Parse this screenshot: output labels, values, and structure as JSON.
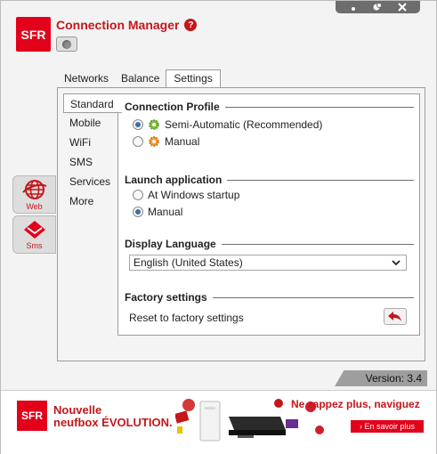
{
  "app": {
    "title": "Connection Manager",
    "logo": "SFR",
    "help": "?"
  },
  "window_controls": [
    "minimize-icon",
    "restore-icon",
    "close-icon"
  ],
  "tabs": [
    {
      "label": "Networks",
      "active": false
    },
    {
      "label": "Balance",
      "active": false
    },
    {
      "label": "Settings",
      "active": true
    }
  ],
  "side_nav": [
    {
      "label": "Standard",
      "active": true
    },
    {
      "label": "Mobile",
      "active": false
    },
    {
      "label": "WiFi",
      "active": false
    },
    {
      "label": "SMS",
      "active": false
    },
    {
      "label": "Services",
      "active": false
    },
    {
      "label": "More",
      "active": false
    }
  ],
  "connection_profile": {
    "title": "Connection Profile",
    "options": [
      {
        "label": "Semi-Automatic (Recommended)",
        "checked": true,
        "icon": "green-gear-icon"
      },
      {
        "label": "Manual",
        "checked": false,
        "icon": "orange-gear-icon"
      }
    ]
  },
  "launch_application": {
    "title": "Launch application",
    "options": [
      {
        "label": "At Windows startup",
        "checked": false
      },
      {
        "label": "Manual",
        "checked": true
      }
    ]
  },
  "display_language": {
    "title": "Display Language",
    "selected": "English (United States)"
  },
  "factory_settings": {
    "title": "Factory settings",
    "reset_label": "Reset to factory settings"
  },
  "left_buttons": [
    {
      "label": "Web",
      "icon": "globe-icon"
    },
    {
      "label": "Sms",
      "icon": "envelope-icon"
    }
  ],
  "version": "Version: 3.4",
  "ad": {
    "logo": "SFR",
    "line1": "Nouvelle",
    "line2": "neufbox ÉVOLUTION.",
    "slogan": "Ne zappez plus, naviguez",
    "cta": "› En savoir plus"
  },
  "colors": {
    "brand_red": "#e2001a",
    "title_red": "#c4171b",
    "radio_blue": "#3b6ea8"
  }
}
